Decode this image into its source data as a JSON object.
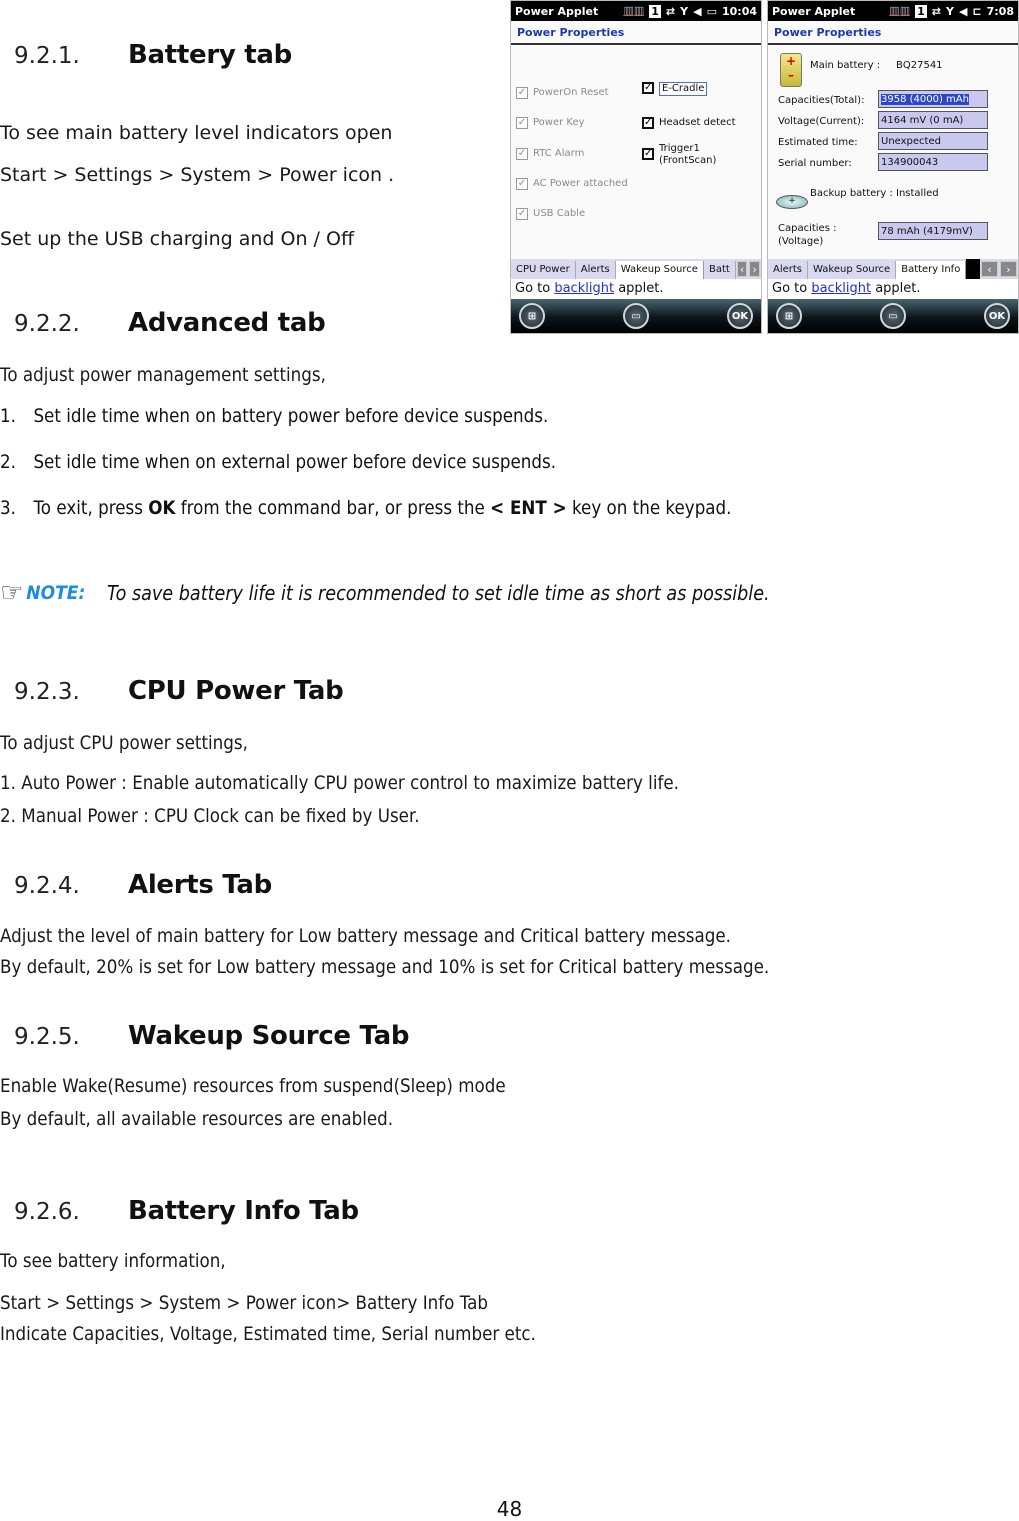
{
  "sections": [
    {
      "number": "9.2.1.",
      "title": "Battery tab",
      "paragraphs": [
        "To see main battery level indicators open",
        "Start > Settings > System > Power icon .",
        "Set up the USB charging and On / Off"
      ]
    },
    {
      "number": "9.2.2.",
      "title": "Advanced tab",
      "intro": "To adjust power management settings,",
      "items": [
        {
          "n": "1.",
          "text": "Set idle time when on battery power before device suspends."
        },
        {
          "n": "2.",
          "text": "Set idle time when on external power before device suspends."
        },
        {
          "n": "3.",
          "pre": "To exit, press ",
          "bold1": "OK",
          "mid": " from the command bar, or press the ",
          "bold2": "< ENT >",
          "post": " key on the keypad."
        }
      ],
      "note": {
        "icon": "pointing-hand-icon",
        "label": "NOTE:",
        "text": "To save battery life it is recommended to set idle time as short as possible.",
        "label_color": "#1b8fd6"
      }
    },
    {
      "number": "9.2.3.",
      "title": "CPU Power Tab",
      "intro": "To adjust CPU power settings,",
      "lines": [
        "1. Auto Power : Enable automatically CPU power control to maximize battery life.",
        "2. Manual Power : CPU Clock can be fixed by User."
      ]
    },
    {
      "number": "9.2.4.",
      "title": "Alerts Tab",
      "lines": [
        "Adjust the level of main battery for Low battery message and Critical battery message.",
        "By default, 20% is set for Low battery message and 10% is set for Critical battery message."
      ]
    },
    {
      "number": "9.2.5.",
      "title": "Wakeup Source Tab",
      "lines": [
        "Enable Wake(Resume) resources from suspend(Sleep) mode",
        "By default, all available resources are enabled."
      ]
    },
    {
      "number": "9.2.6.",
      "title": "Battery Info Tab",
      "intro": "To see battery information,",
      "lines": [
        "Start > Settings > System > Power icon> Battery Info Tab",
        "Indicate Capacities, Voltage, Estimated time, Serial number etc."
      ]
    }
  ],
  "page_number": "48",
  "screens": [
    {
      "app_title": "Power Applet",
      "time": "10:04",
      "input_indicator": "1",
      "header": "Power Properties",
      "left_checks": [
        {
          "label": "PowerOn Reset",
          "checked": true,
          "enabled": false
        },
        {
          "label": "Power Key",
          "checked": true,
          "enabled": false
        },
        {
          "label": "RTC Alarm",
          "checked": true,
          "enabled": false
        },
        {
          "label": "AC Power attached",
          "checked": true,
          "enabled": false
        },
        {
          "label": "USB Cable",
          "checked": true,
          "enabled": false
        }
      ],
      "right_checks": [
        {
          "label": "E-Cradle",
          "checked": true,
          "enabled": true
        },
        {
          "label": "Headset detect",
          "checked": true,
          "enabled": true
        },
        {
          "label": "Trigger1",
          "label2": "(FrontScan)",
          "checked": true,
          "enabled": true
        }
      ],
      "tabs": [
        "CPU Power",
        "Alerts",
        "Wakeup Source",
        "Batt"
      ],
      "active_tab": "Wakeup Source",
      "goto_prefix": "Go to ",
      "goto_link": "backlight",
      "goto_suffix": " applet.",
      "cmd_ok": "OK"
    },
    {
      "app_title": "Power Applet",
      "time": "7:08",
      "input_indicator": "1",
      "header": "Power Properties",
      "main_battery_label": "Main battery :",
      "main_battery_value": "BQ27541",
      "fields": [
        {
          "label": "Capacities(Total):",
          "value": "3958 (4000) mAh"
        },
        {
          "label": "Voltage(Current):",
          "value": "4164 mV (0 mA)"
        },
        {
          "label": "Estimated time:",
          "value": "Unexpected"
        },
        {
          "label": "Serial number:",
          "value": "134900043"
        }
      ],
      "backup_battery_label": "Backup battery :",
      "backup_battery_value": "Installed",
      "backup_cap_label": "Capacities :",
      "backup_cap_label2": "(Voltage)",
      "backup_cap_value": "78 mAh (4179mV)",
      "tabs": [
        "Alerts",
        "Wakeup Source",
        "Battery Info"
      ],
      "active_tab": "Battery Info",
      "goto_prefix": "Go to ",
      "goto_link": "backlight",
      "goto_suffix": " applet.",
      "cmd_ok": "OK"
    }
  ]
}
